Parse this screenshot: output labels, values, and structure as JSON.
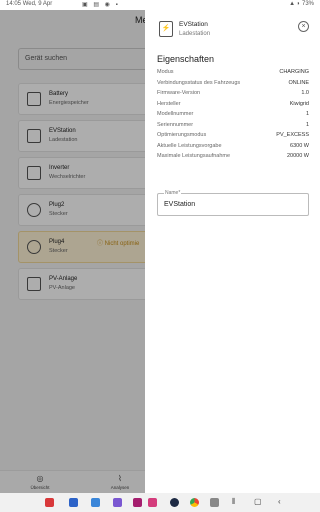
{
  "statusbar": {
    "time": "14:05",
    "date": "Wed, 9 Apr",
    "battery": "73%",
    "icons": "▣ ▤ ◉ ▪"
  },
  "background": {
    "title": "Me",
    "search_placeholder": "Gerät suchen",
    "devices": [
      {
        "name": "Battery",
        "type": "Energiespeicher",
        "icon": "battery-icon",
        "warning": ""
      },
      {
        "name": "EVStation",
        "type": "Ladestation",
        "icon": "ev-station-icon",
        "warning": ""
      },
      {
        "name": "Inverter",
        "type": "Wechselrichter",
        "icon": "inverter-icon",
        "warning": ""
      },
      {
        "name": "Plug2",
        "type": "Stecker",
        "icon": "plug-icon",
        "warning": ""
      },
      {
        "name": "Plug4",
        "type": "Stecker",
        "icon": "plug-icon",
        "warning": "Nicht optimie"
      },
      {
        "name": "PV-Anlage",
        "type": "PV-Anlage",
        "icon": "solar-panel-icon",
        "warning": ""
      }
    ],
    "bottom_nav": [
      {
        "label": "Übersicht",
        "icon": "overview-icon"
      },
      {
        "label": "Analysen",
        "icon": "analytics-icon"
      }
    ]
  },
  "panel": {
    "title": "EVStation",
    "subtitle": "Ladestation",
    "section": "Eigenschaften",
    "properties": [
      {
        "label": "Modus",
        "value": "CHARGING"
      },
      {
        "label": "Verbindungsstatus des Fahrzeugs",
        "value": "ONLINE"
      },
      {
        "label": "Firmware-Version",
        "value": "1.0"
      },
      {
        "label": "Hersteller",
        "value": "Kiwigrid"
      },
      {
        "label": "Modellnummer",
        "value": "1"
      },
      {
        "label": "Seriennummer",
        "value": "1"
      },
      {
        "label": "Optimierungsmodus",
        "value": "PV_EXCESS"
      },
      {
        "label": "Aktuelle Leistungsvorgabe",
        "value": "6300 W"
      },
      {
        "label": "Maximale Leistungsaufnahme",
        "value": "20000 W"
      }
    ],
    "name_field": {
      "label": "Name*",
      "value": "EVStation"
    }
  },
  "colors": {
    "warning_bg": "#fff3d6",
    "warning_text": "#c8901a",
    "scrim": "rgba(0,0,0,0.32)"
  }
}
